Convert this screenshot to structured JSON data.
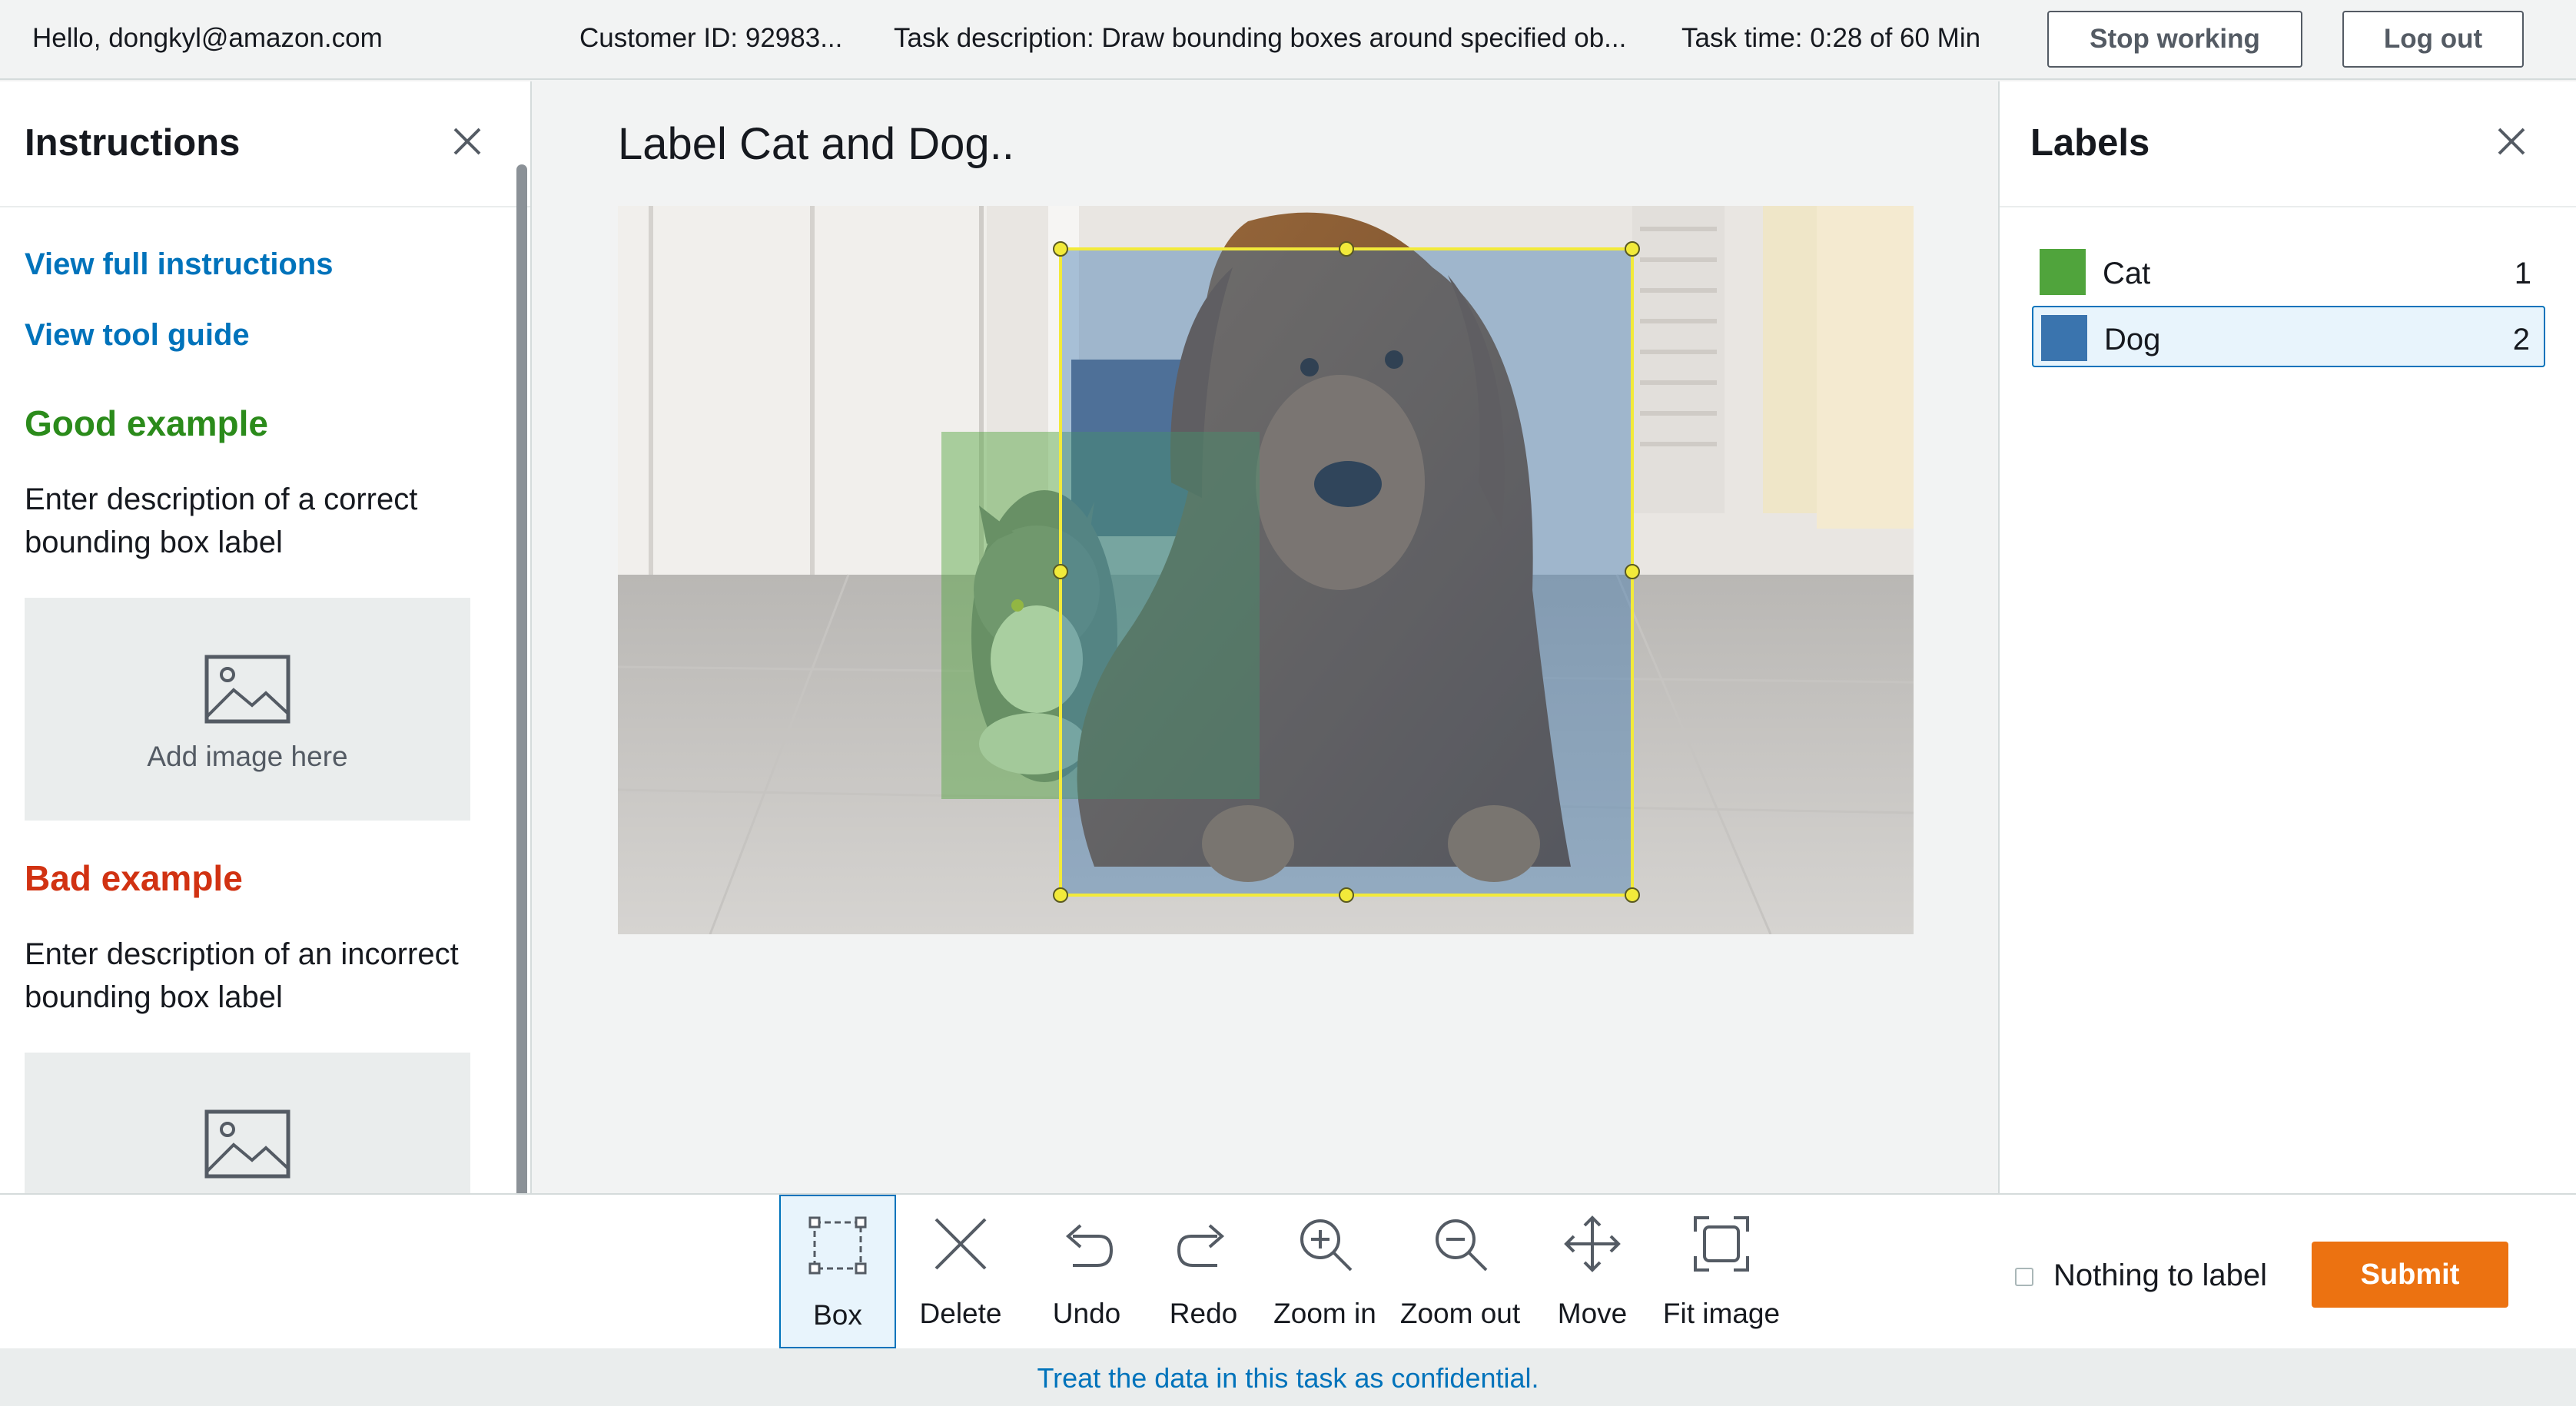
{
  "header": {
    "greeting": "Hello, dongkyl@amazon.com",
    "customer_id": "Customer ID: 92983...",
    "task_description": "Task description: Draw bounding boxes around specified ob...",
    "task_time": "Task time: 0:28 of 60 Min",
    "stop_button": "Stop working",
    "logout_button": "Log out"
  },
  "instructions": {
    "title": "Instructions",
    "full_link": "View full instructions",
    "tool_link": "View tool guide",
    "good_title": "Good example",
    "good_desc": "Enter description of a correct bounding box label",
    "add_image": "Add image here",
    "bad_title": "Bad example",
    "bad_desc": "Enter description of an incorrect bounding box label"
  },
  "canvas": {
    "title": "Label Cat and Dog.."
  },
  "labels": {
    "title": "Labels",
    "items": [
      {
        "name": "Cat",
        "count": "1",
        "color": "#50a43c"
      },
      {
        "name": "Dog",
        "count": "2",
        "color": "#3a74ae"
      }
    ]
  },
  "toolbar": {
    "tools": [
      "Box",
      "Delete",
      "Undo",
      "Redo",
      "Zoom in",
      "Zoom out",
      "Move",
      "Fit image"
    ],
    "selected_tool": "Box",
    "nothing_to_label": "Nothing to label",
    "submit": "Submit"
  },
  "footer": {
    "text": "Treat the data in this task as confidential."
  },
  "colors": {
    "accent": "#0073bb",
    "submit": "#ec7211",
    "good": "#2b8b1b",
    "bad": "#d13212",
    "selected_box": "#f2ea3a"
  }
}
